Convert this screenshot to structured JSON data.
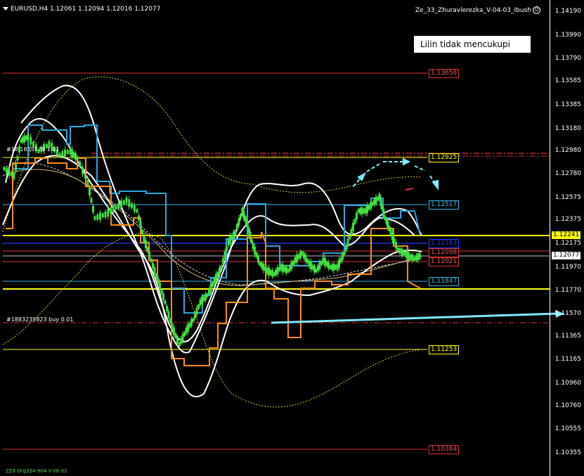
{
  "symbol_header": "EURUSD,H4  1.12061 1.12094 1.12016 1.12077",
  "ea_name": "Ze_33_Zhuravlerezka_V-04-03_Ibush",
  "message": "Lilin tidak mencukupi",
  "axis_prices": [
    "1.14190",
    "1.13990",
    "1.13790",
    "1.13585",
    "1.13385",
    "1.13180",
    "1.12980",
    "1.12780",
    "1.12575",
    "1.12375",
    "1.12175",
    "1.11970",
    "1.11770",
    "1.11570",
    "1.11365",
    "1.11165",
    "1.10960",
    "1.10760",
    "1.10555",
    "1.10355"
  ],
  "axis_tags": [
    {
      "price": "1.12241",
      "bg": "#ffff00",
      "fg": "#000000"
    },
    {
      "price": "1.12077",
      "bg": "#ffffff",
      "fg": "#000000"
    }
  ],
  "level_tags": [
    {
      "price": "1.13658",
      "border": "#e03030",
      "fg": "#ff5050"
    },
    {
      "price": "1.12925",
      "border": "#ffff00",
      "fg": "#ffff00"
    },
    {
      "price": "1.12517",
      "border": "#36b4e6",
      "fg": "#36b4e6"
    },
    {
      "price": "1.12183",
      "border": "#1f3dff",
      "fg": "#1f3dff"
    },
    {
      "price": "1.12098",
      "border": "#e03030",
      "fg": "#ff5050"
    },
    {
      "price": "1.12021",
      "border": "#e03030",
      "fg": "#ff5050"
    },
    {
      "price": "1.11847",
      "border": "#36b4e6",
      "fg": "#36b4e6"
    },
    {
      "price": "1.11253",
      "border": "#ffff00",
      "fg": "#ffff00"
    },
    {
      "price": "1.10384",
      "border": "#e03030",
      "fg": "#ff5050"
    }
  ],
  "order_labels": [
    "#18 1833579 1.01",
    "#1883235823 buy 0.01"
  ],
  "footer_text": "ZZ8 Org334-904 V-06-02",
  "colors": {
    "background": "#000000",
    "candles": "#3fe03f",
    "envelope": "#ffffff",
    "channel_blue": "#2ba6e0",
    "channel_orange": "#ff8c1a",
    "accent_arrow": "#7fe9ff"
  }
}
